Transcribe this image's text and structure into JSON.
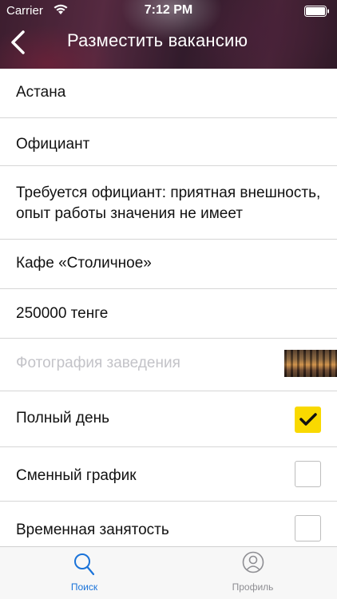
{
  "status_bar": {
    "carrier": "Carrier",
    "time": "7:12 PM"
  },
  "nav": {
    "title": "Разместить вакансию"
  },
  "form": {
    "city": "Астана",
    "position": "Официант",
    "description": "Требуется официант: приятная внешность, опыт работы значения не имеет",
    "company": "Кафе «Столичное»",
    "salary": "250000 тенге",
    "photo_placeholder": "Фотография заведения",
    "schedule_options": [
      {
        "label": "Полный день",
        "checked": true
      },
      {
        "label": "Сменный график",
        "checked": false
      },
      {
        "label": "Временная занятость",
        "checked": false
      }
    ]
  },
  "tabbar": {
    "tabs": [
      {
        "label": "Поиск",
        "active": true,
        "icon": "search-icon"
      },
      {
        "label": "Профиль",
        "active": false,
        "icon": "profile-icon"
      }
    ]
  },
  "colors": {
    "accent": "#1a73d9",
    "checkbox_checked": "#f9d900",
    "placeholder": "#c3c3c8"
  }
}
